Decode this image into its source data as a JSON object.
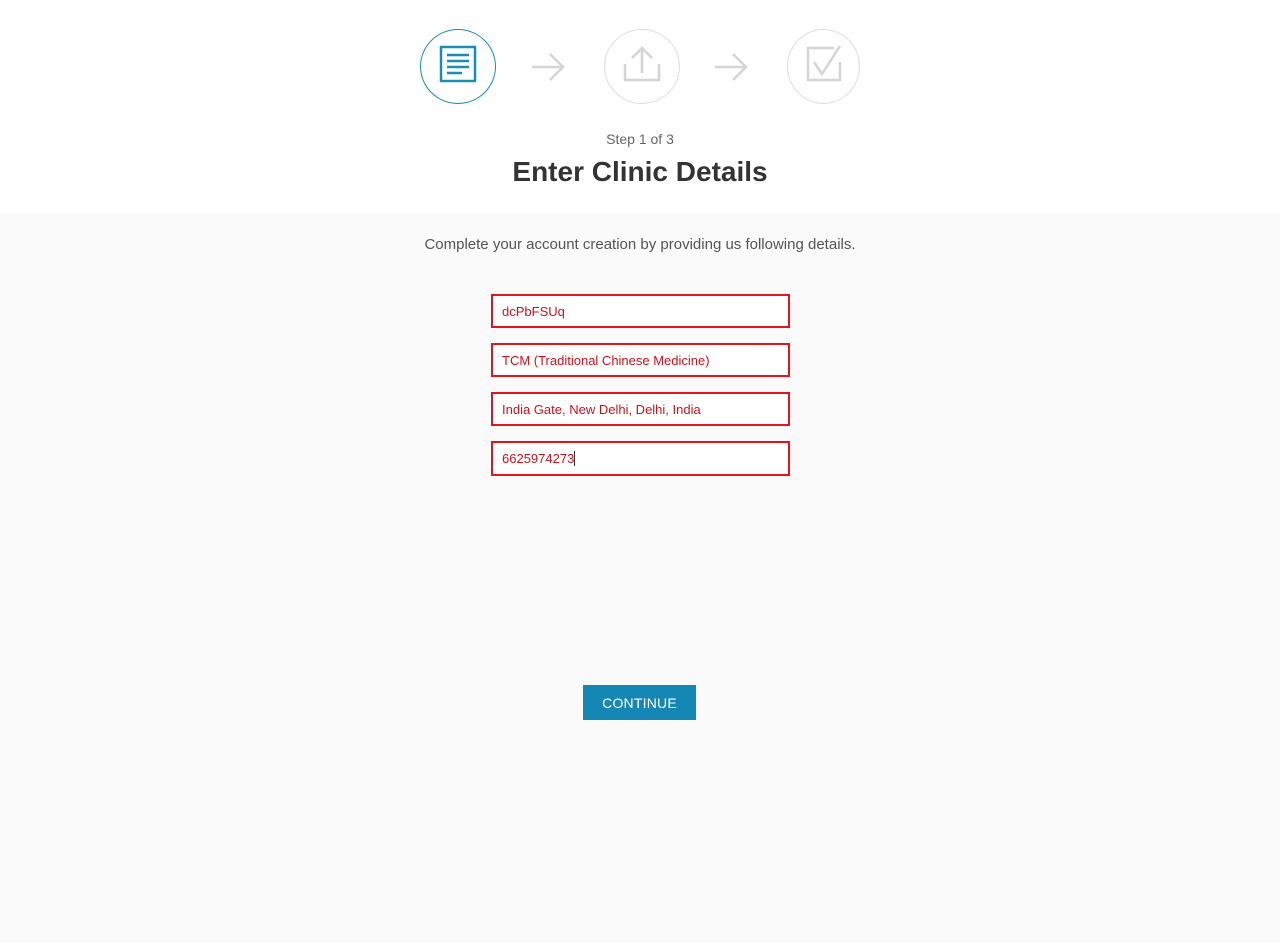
{
  "wizard": {
    "step_label": "Step 1 of 3",
    "title": "Enter Clinic Details",
    "steps": [
      {
        "icon": "document-icon",
        "state": "active"
      },
      {
        "icon": "upload-icon",
        "state": "inactive"
      },
      {
        "icon": "checkmark-icon",
        "state": "inactive"
      }
    ]
  },
  "form": {
    "subtitle": "Complete your account creation by providing us following details.",
    "clinic_name": "dcPbFSUq",
    "specialty": "TCM (Traditional Chinese Medicine)",
    "address": "India Gate, New Delhi, Delhi, India",
    "phone": "6625974273"
  },
  "actions": {
    "continue_label": "CONTINUE"
  },
  "colors": {
    "accent": "#1487b5",
    "error": "#e0161e",
    "inactive": "#dedede"
  }
}
